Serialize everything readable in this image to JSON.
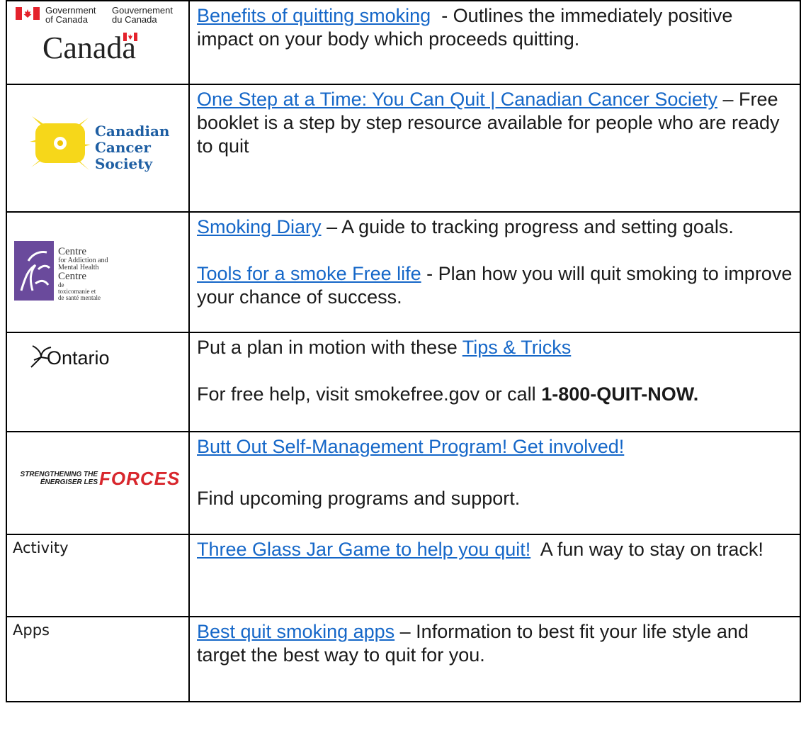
{
  "rows": [
    {
      "logo": {
        "type": "gov-canada",
        "line1a": "Government",
        "line1b": "of Canada",
        "line2a": "Gouvernement",
        "line2b": "du Canada",
        "wordmark": "Canada"
      },
      "desc": {
        "link1": "Benefits of quitting smoking",
        "text1": "  - Outlines the immediately positive impact on your body which proceeds quitting."
      }
    },
    {
      "logo": {
        "type": "ccs",
        "line1": "Canadian",
        "line2": "Cancer",
        "line3": "Society"
      },
      "desc": {
        "link1": "One Step at a Time: You Can Quit | Canadian Cancer Society",
        "text1": " – Free booklet is a step by step resource available for people who are ready to quit"
      }
    },
    {
      "logo": {
        "type": "camh",
        "line1": "Centre",
        "line2": "for Addiction and",
        "line3": "Mental Health",
        "line4": "Centre",
        "line5": "de",
        "line6": "toxicomanie et",
        "line7": "de santé mentale"
      },
      "desc": {
        "link1": "Smoking Diary",
        "text1": " – A guide to tracking progress and setting goals.",
        "link2": "Tools for a smoke Free life",
        "text2": " - Plan how you will quit smoking to improve your chance of success."
      }
    },
    {
      "logo": {
        "type": "ontario",
        "text": "Ontario"
      },
      "desc": {
        "text0": "Put a plan in motion with these ",
        "link1": "Tips & Tricks",
        "text2": "For free help, visit smokefree.gov or call ",
        "bold2": "1-800-QUIT-NOW."
      }
    },
    {
      "logo": {
        "type": "stf",
        "line1": "STRENGTHENING THE",
        "line2": "ÉNERGISER LES",
        "word": "FORCES"
      },
      "desc": {
        "link1": "Butt Out Self-Management Program! Get involved!",
        "text2": "Find upcoming programs and support."
      }
    },
    {
      "label": "Activity",
      "desc": {
        "link1": "Three Glass Jar Game to help you quit!",
        "text1": "  A fun way to stay on track!"
      }
    },
    {
      "label": "Apps",
      "desc": {
        "link1": "Best quit smoking apps",
        "text1": " – Information to best fit your life style and target the best way to quit for you."
      }
    }
  ],
  "colors": {
    "link": "#1567c8",
    "border": "#000000",
    "canada_red": "#e4222c",
    "ccs_yellow": "#f6d71a",
    "ccs_blue": "#1f5fa3",
    "camh_purple": "#6a4a9c",
    "forces_red": "#d8262c"
  }
}
